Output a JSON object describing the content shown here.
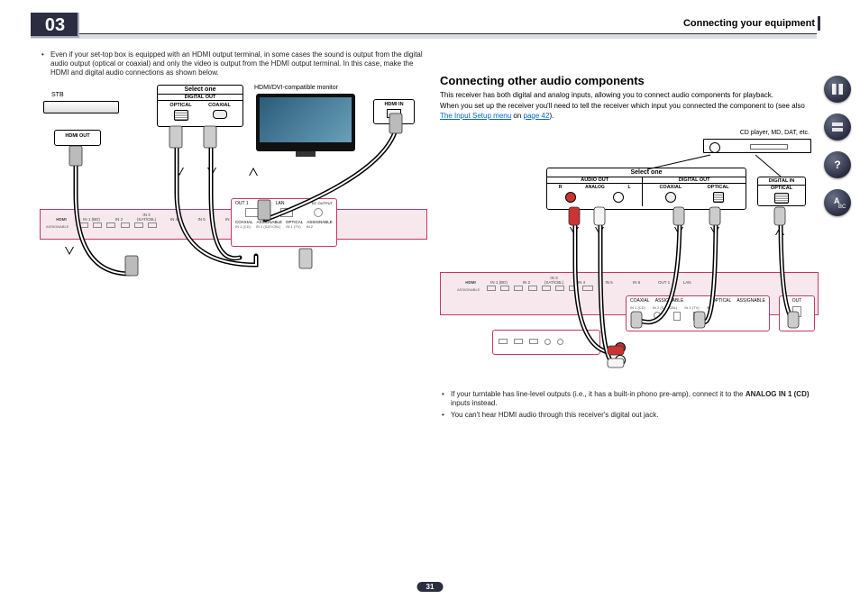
{
  "page": {
    "chapter_number": "03",
    "section_title": "Connecting your equipment",
    "page_number": "31"
  },
  "left": {
    "bullet1": "Even if your set-top box is equipped with an HDMI output terminal, in some cases the sound is output from the digital audio output (optical or coaxial) and only the video is output from the HDMI output terminal. In this case, make the HDMI and digital audio connections as shown below."
  },
  "right": {
    "heading": "Connecting other audio components",
    "p1": "This receiver has both digital and analog inputs, allowing you to connect audio components for playback.",
    "p2_a": "When you set up the receiver you'll need to tell the receiver which input you connected the component to (see also ",
    "p2_link": "The Input Setup menu",
    "p2_b": " on ",
    "p2_page": "page 42",
    "p2_c": ").",
    "bullet1a": "If your turntable has line-level outputs (i.e., it has a built-in phono pre-amp), connect it to the ",
    "bullet1b": "ANALOG IN 1 (CD)",
    "bullet1c": " inputs instead.",
    "bullet2": "You can't hear HDMI audio through this receiver's digital out jack."
  },
  "dia1": {
    "stb_label": "STB",
    "hdmi_out": "HDMI OUT",
    "select_one": "Select one",
    "digital_out": "DIGITAL OUT",
    "optical": "OPTICAL",
    "coaxial": "COAXIAL",
    "monitor_label": "HDMI/DVI-compatible monitor",
    "hdmi_in": "HDMI IN",
    "panel_hdmi": "HDMI",
    "panel_assignable": "ASSIGNABLE",
    "panel_coaxial": "COAXIAL",
    "panel_optical": "OPTICAL",
    "panel_lan": "LAN",
    "ports": [
      "IN 1 (BD)",
      "IN 2",
      "IN 3 (SAT/CBL)",
      "IN 4",
      "IN 5",
      "IN 6",
      "OUT 1"
    ],
    "sub_ports": [
      "IN 1 (CD)",
      "IN 2 (SAT/CBL)",
      "IN 1 (TV)",
      "IN 2"
    ]
  },
  "dia2": {
    "device_label": "CD player, MD, DAT, etc.",
    "select_one": "Select one",
    "audio_out": "AUDIO OUT",
    "r": "R",
    "analog": "ANALOG",
    "l": "L",
    "digital_out": "DIGITAL OUT",
    "coaxial": "COAXIAL",
    "optical": "OPTICAL",
    "digital_in": "DIGITAL IN",
    "panel_hdmi": "HDMI",
    "panel_assignable": "ASSIGNABLE",
    "panel_coaxial": "COAXIAL",
    "panel_optical": "OPTICAL",
    "panel_out": "OUT",
    "panel_lan": "LAN",
    "ports": [
      "IN 1 (BD)",
      "IN 2",
      "IN 3 (SAT/CBL)",
      "IN 4",
      "IN 5",
      "IN 6",
      "OUT 1"
    ],
    "sub_ports": [
      "IN 1 (CD)",
      "IN 2 (SAT/CBL)",
      "IN 1 (TV)",
      "IN 2"
    ]
  },
  "sidebar": {
    "icons": [
      "book-icon",
      "device-icon",
      "help-icon",
      "glossary-icon"
    ]
  }
}
